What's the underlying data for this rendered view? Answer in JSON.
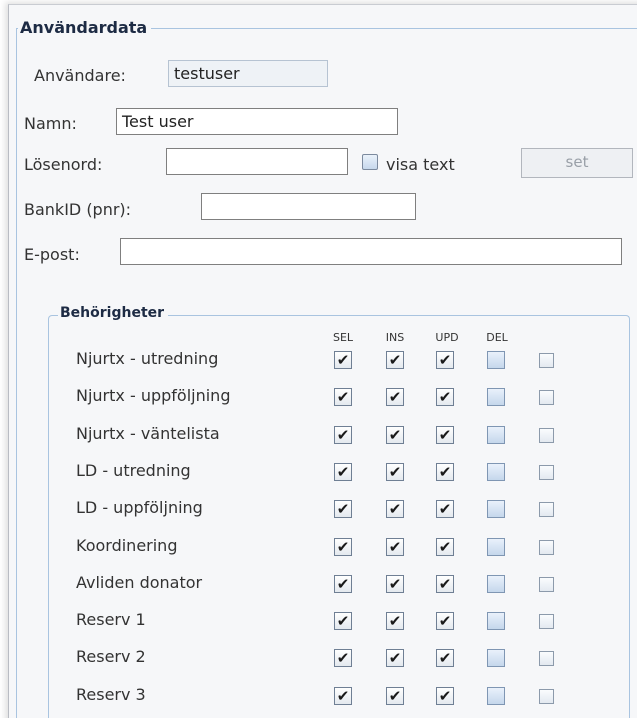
{
  "user_data": {
    "legend": "Användardata",
    "username_label": "Användare:",
    "username_value": "testuser",
    "name_label": "Namn:",
    "name_value": "Test user",
    "password_label": "Lösenord:",
    "password_value": "",
    "show_text_label": "visa text",
    "show_text_checked": false,
    "set_button": "set",
    "bankid_label": "BankID (pnr):",
    "bankid_value": "",
    "email_label": "E-post:",
    "email_value": ""
  },
  "permissions": {
    "legend": "Behörigheter",
    "columns": [
      "SEL",
      "INS",
      "UPD",
      "DEL",
      ""
    ],
    "rows": [
      {
        "label": "Njurtx - utredning",
        "checks": [
          true,
          true,
          true,
          false,
          false
        ]
      },
      {
        "label": "Njurtx - uppföljning",
        "checks": [
          true,
          true,
          true,
          false,
          false
        ]
      },
      {
        "label": "Njurtx - väntelista",
        "checks": [
          true,
          true,
          true,
          false,
          false
        ]
      },
      {
        "label": "LD - utredning",
        "checks": [
          true,
          true,
          true,
          false,
          false
        ]
      },
      {
        "label": "LD - uppföljning",
        "checks": [
          true,
          true,
          true,
          false,
          false
        ]
      },
      {
        "label": "Koordinering",
        "checks": [
          true,
          true,
          true,
          false,
          false
        ]
      },
      {
        "label": "Avliden donator",
        "checks": [
          true,
          true,
          true,
          false,
          false
        ]
      },
      {
        "label": "Reserv 1",
        "checks": [
          true,
          true,
          true,
          false,
          false
        ]
      },
      {
        "label": "Reserv 2",
        "checks": [
          true,
          true,
          true,
          false,
          false
        ]
      },
      {
        "label": "Reserv 3",
        "checks": [
          true,
          true,
          true,
          false,
          false
        ]
      }
    ]
  },
  "check_glyph": "✔"
}
